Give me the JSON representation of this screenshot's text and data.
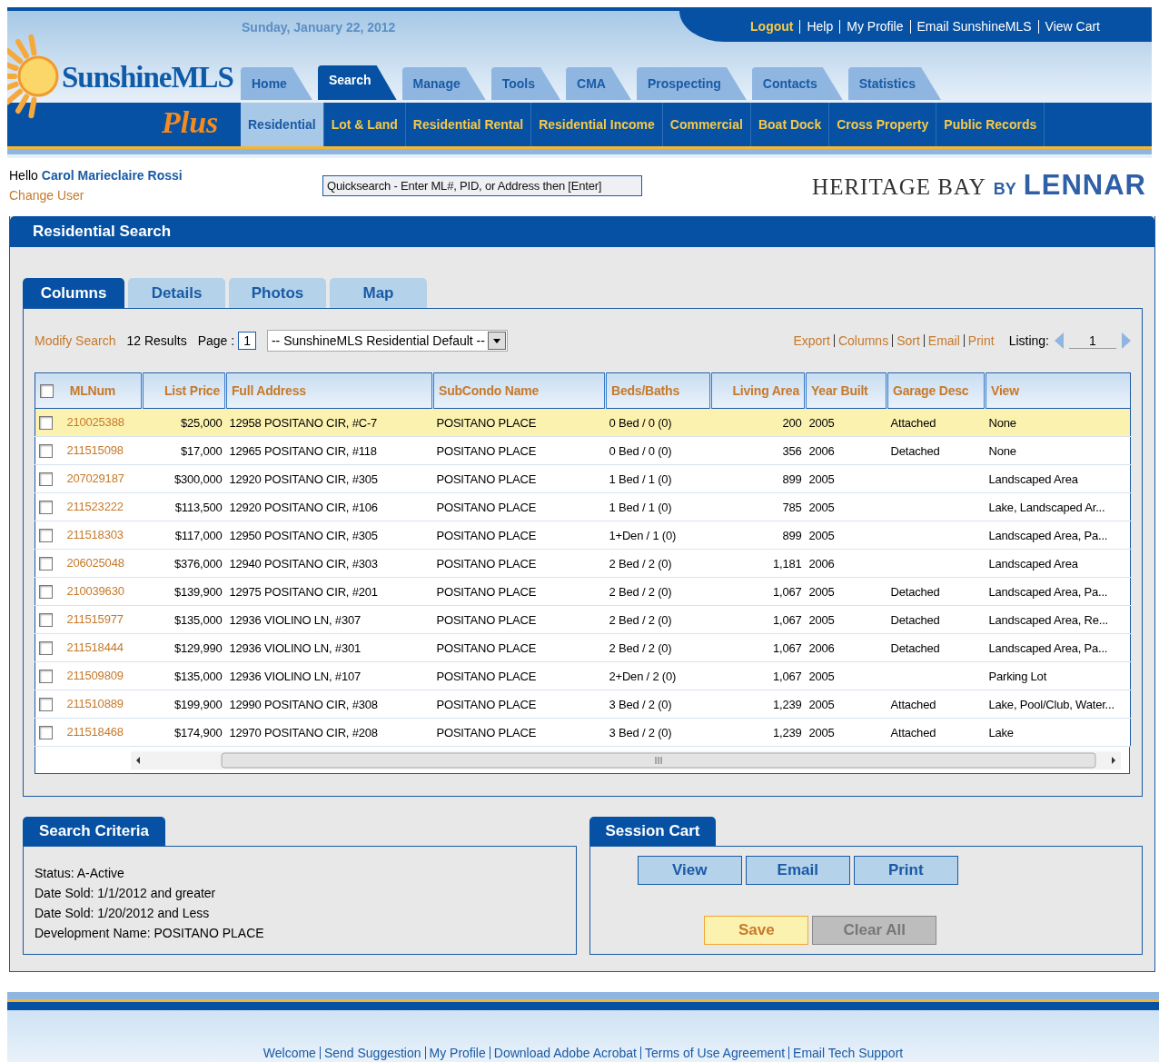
{
  "header": {
    "date": "Sunday, January 22, 2012",
    "top_links": [
      {
        "label": "Logout",
        "highlighted": true
      },
      {
        "label": "Help",
        "highlighted": false
      },
      {
        "label": "My Profile",
        "highlighted": false
      },
      {
        "label": "Email SunshineMLS",
        "highlighted": false
      },
      {
        "label": "View Cart",
        "highlighted": false
      }
    ],
    "logo": {
      "name": "SunshineMLS",
      "suffix": "Plus"
    },
    "main_tabs": [
      {
        "label": "Home",
        "selected": false
      },
      {
        "label": "Search",
        "selected": true
      },
      {
        "label": "Manage",
        "selected": false
      },
      {
        "label": "Tools",
        "selected": false
      },
      {
        "label": "CMA",
        "selected": false
      },
      {
        "label": "Prospecting",
        "selected": false
      },
      {
        "label": "Contacts",
        "selected": false
      },
      {
        "label": "Statistics",
        "selected": false
      }
    ],
    "sub_tabs": [
      {
        "label": "Residential",
        "selected": true
      },
      {
        "label": "Lot & Land",
        "selected": false
      },
      {
        "label": "Residential Rental",
        "selected": false
      },
      {
        "label": "Residential Income",
        "selected": false
      },
      {
        "label": "Commercial",
        "selected": false
      },
      {
        "label": "Boat Dock",
        "selected": false
      },
      {
        "label": "Cross Property",
        "selected": false
      },
      {
        "label": "Public Records",
        "selected": false
      }
    ]
  },
  "user": {
    "greeting": "Hello",
    "name": "Carol Marieclaire Rossi",
    "change_user": "Change User"
  },
  "quicksearch": {
    "placeholder": "Quicksearch - Enter ML#, PID, or Address then [Enter]"
  },
  "brand": {
    "name": "HERITAGE BAY",
    "by": "BY",
    "builder": "LENNAR"
  },
  "panel": {
    "title": "Residential Search",
    "view_tabs": [
      {
        "label": "Columns",
        "selected": true
      },
      {
        "label": "Details",
        "selected": false
      },
      {
        "label": "Photos",
        "selected": false
      },
      {
        "label": "Map",
        "selected": false
      }
    ],
    "toolbar": {
      "modify_search": "Modify Search",
      "results": "12 Results",
      "page_label": "Page :",
      "page": "1",
      "layout": "-- SunshineMLS Residential Default --",
      "actions": [
        "Export",
        "Columns",
        "Sort",
        "Email",
        "Print"
      ],
      "listing_label": "Listing:",
      "listing": "1"
    },
    "table": {
      "all_checked": false,
      "columns": [
        {
          "label": "MLNum"
        },
        {
          "label": "List Price"
        },
        {
          "label": "Full Address"
        },
        {
          "label": "SubCondo Name"
        },
        {
          "label": "Beds/Baths"
        },
        {
          "label": "Living Area"
        },
        {
          "label": "Year Built"
        },
        {
          "label": "Garage Desc"
        },
        {
          "label": "View"
        }
      ],
      "rows": [
        {
          "selected": true,
          "checked": false,
          "mlnum": "210025388",
          "price": "$25,000",
          "address": "12958 POSITANO CIR, #C-7",
          "subcondo": "POSITANO PLACE",
          "beds": "0 Bed / 0 (0)",
          "area": "200",
          "year": "2005",
          "garage": "Attached",
          "view": "None"
        },
        {
          "selected": false,
          "checked": false,
          "mlnum": "211515098",
          "price": "$17,000",
          "address": "12965 POSITANO CIR, #118",
          "subcondo": "POSITANO PLACE",
          "beds": "0 Bed / 0 (0)",
          "area": "356",
          "year": "2006",
          "garage": "Detached",
          "view": "None"
        },
        {
          "selected": false,
          "checked": false,
          "mlnum": "207029187",
          "price": "$300,000",
          "address": "12920 POSITANO CIR, #305",
          "subcondo": "POSITANO PLACE",
          "beds": "1 Bed / 1 (0)",
          "area": "899",
          "year": "2005",
          "view": "Landscaped Area"
        },
        {
          "selected": false,
          "checked": false,
          "mlnum": "211523222",
          "price": "$113,500",
          "address": "12920 POSITANO CIR, #106",
          "subcondo": "POSITANO PLACE",
          "beds": "1 Bed / 1 (0)",
          "area": "785",
          "year": "2005",
          "view": "Lake, Landscaped Ar..."
        },
        {
          "selected": false,
          "checked": false,
          "mlnum": "211518303",
          "price": "$117,000",
          "address": "12950 POSITANO CIR, #305",
          "subcondo": "POSITANO PLACE",
          "beds": "1+Den / 1 (0)",
          "area": "899",
          "year": "2005",
          "view": "Landscaped Area, Pa..."
        },
        {
          "selected": false,
          "checked": false,
          "mlnum": "206025048",
          "price": "$376,000",
          "address": "12940 POSITANO CIR, #303",
          "subcondo": "POSITANO PLACE",
          "beds": "2 Bed / 2 (0)",
          "area": "1,181",
          "year": "2006",
          "view": "Landscaped Area"
        },
        {
          "selected": false,
          "checked": false,
          "mlnum": "210039630",
          "price": "$139,900",
          "address": "12975 POSITANO CIR, #201",
          "subcondo": "POSITANO PLACE",
          "beds": "2 Bed / 2 (0)",
          "area": "1,067",
          "year": "2005",
          "garage": "Detached",
          "view": "Landscaped Area, Pa..."
        },
        {
          "selected": false,
          "checked": false,
          "mlnum": "211515977",
          "price": "$135,000",
          "address": "12936 VIOLINO LN, #307",
          "subcondo": "POSITANO PLACE",
          "beds": "2 Bed / 2 (0)",
          "area": "1,067",
          "year": "2005",
          "garage": "Detached",
          "view": "Landscaped Area, Re..."
        },
        {
          "selected": false,
          "checked": false,
          "mlnum": "211518444",
          "price": "$129,990",
          "address": "12936 VIOLINO LN, #301",
          "subcondo": "POSITANO PLACE",
          "beds": "2 Bed / 2 (0)",
          "area": "1,067",
          "year": "2006",
          "garage": "Detached",
          "view": "Landscaped Area, Pa..."
        },
        {
          "selected": false,
          "checked": false,
          "mlnum": "211509809",
          "price": "$135,000",
          "address": "12936 VIOLINO LN, #107",
          "subcondo": "POSITANO PLACE",
          "beds": "2+Den / 2 (0)",
          "area": "1,067",
          "year": "2005",
          "view": "Parking Lot"
        },
        {
          "selected": false,
          "checked": false,
          "mlnum": "211510889",
          "price": "$199,900",
          "address": "12990 POSITANO CIR, #308",
          "subcondo": "POSITANO PLACE",
          "beds": "3 Bed / 2 (0)",
          "area": "1,239",
          "year": "2005",
          "garage": "Attached",
          "view": "Lake, Pool/Club, Water..."
        },
        {
          "selected": false,
          "checked": false,
          "mlnum": "211518468",
          "price": "$174,900",
          "address": "12970 POSITANO CIR, #208",
          "subcondo": "POSITANO PLACE",
          "beds": "3 Bed / 2 (0)",
          "area": "1,239",
          "year": "2005",
          "garage": "Attached",
          "view": "Lake"
        }
      ]
    }
  },
  "criteria": {
    "title": "Search Criteria",
    "lines": [
      "Status: A-Active",
      "Date Sold: 1/1/2012 and greater",
      "Date Sold: 1/20/2012 and Less",
      "Development Name: POSITANO PLACE"
    ]
  },
  "cart": {
    "title": "Session Cart",
    "buttons": [
      {
        "label": "View",
        "kind": "action"
      },
      {
        "label": "Email",
        "kind": "action"
      },
      {
        "label": "Print",
        "kind": "action"
      },
      {
        "label": "Save",
        "kind": "save"
      },
      {
        "label": "Clear All",
        "kind": "clear"
      }
    ]
  },
  "footer": {
    "links": [
      "Welcome",
      "Send Suggestion",
      "My Profile",
      "Download Adobe Acrobat",
      "Terms of Use Agreement",
      "Email Tech Support"
    ]
  }
}
